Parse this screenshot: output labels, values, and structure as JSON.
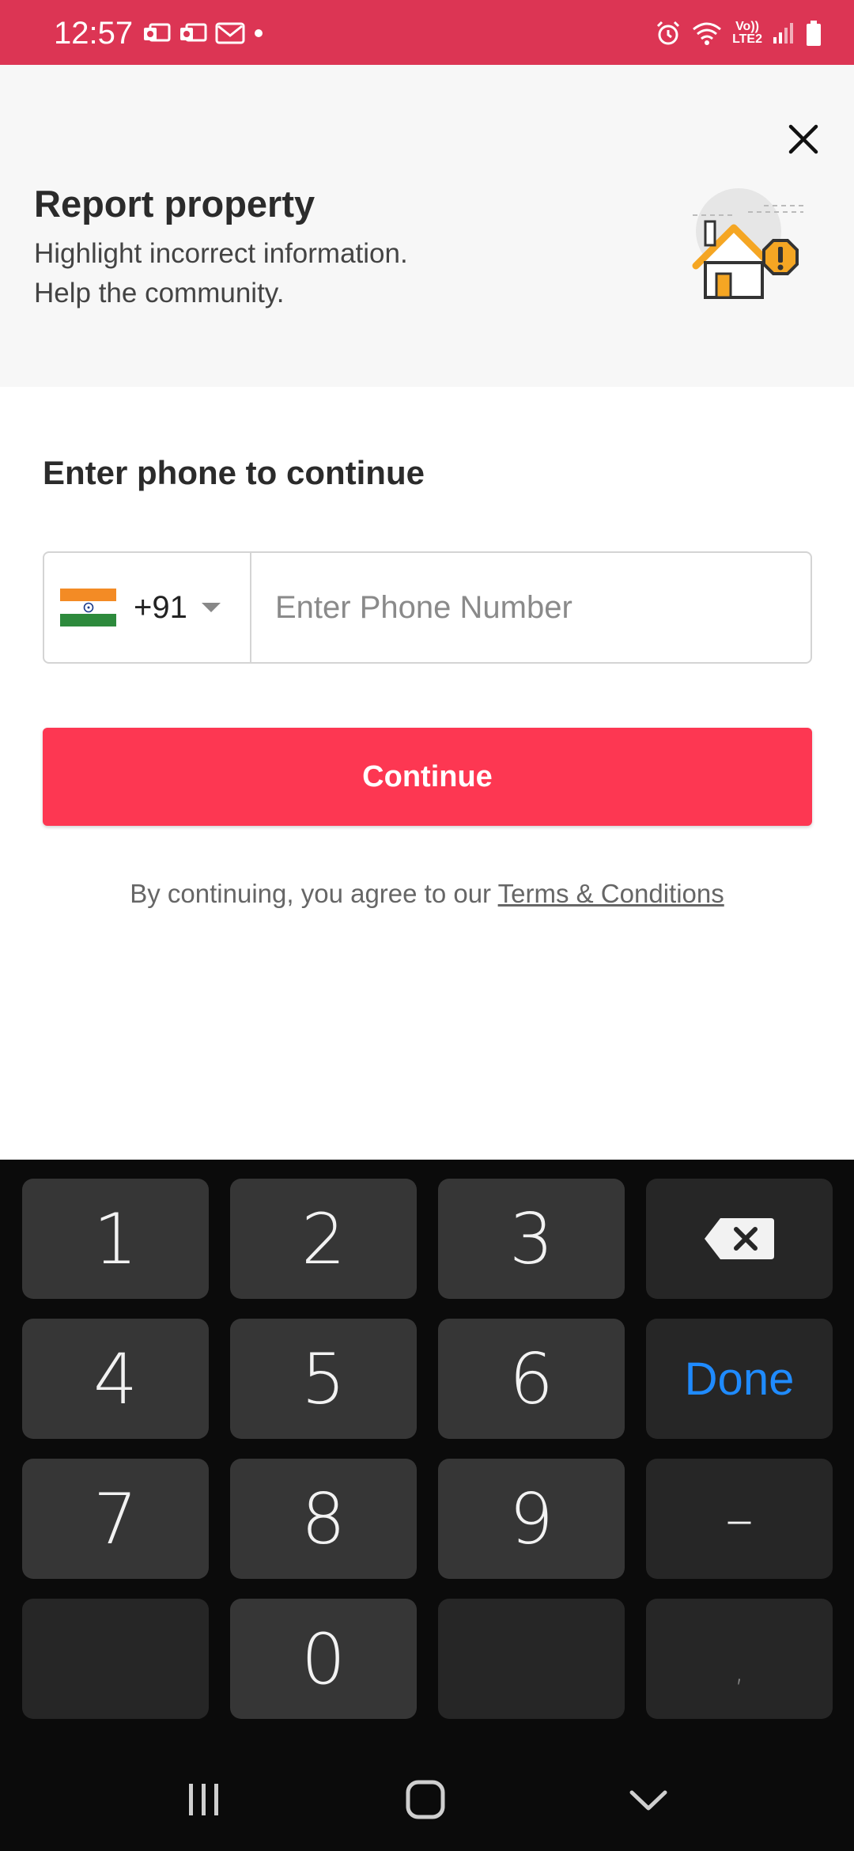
{
  "status_bar": {
    "time": "12:57",
    "network_label_top": "Vo))",
    "network_label_bottom": "LTE2",
    "background_color": "#dc3554"
  },
  "header": {
    "title": "Report property",
    "subtitle_line1": "Highlight incorrect information.",
    "subtitle_line2": "Help the community.",
    "close_icon": "close-icon",
    "illustration_icon": "house-warning-icon"
  },
  "form": {
    "heading": "Enter phone to continue",
    "country_code": "+91",
    "country_flag": "india-flag-icon",
    "phone_placeholder": "Enter Phone Number",
    "phone_value": "",
    "continue_label": "Continue",
    "terms_prefix": "By continuing, you agree to our ",
    "terms_link": "Terms & Conditions",
    "accent_color": "#fd3752"
  },
  "keyboard": {
    "keys": [
      "1",
      "2",
      "3",
      "4",
      "5",
      "6",
      "7",
      "8",
      "9",
      "0"
    ],
    "backspace_icon": "backspace-icon",
    "done_label": "Done",
    "dash_label": "–",
    "comma_label": ","
  },
  "nav_bar": {
    "recents_icon": "recents-icon",
    "home_icon": "home-icon",
    "back_icon": "hide-keyboard-icon"
  }
}
